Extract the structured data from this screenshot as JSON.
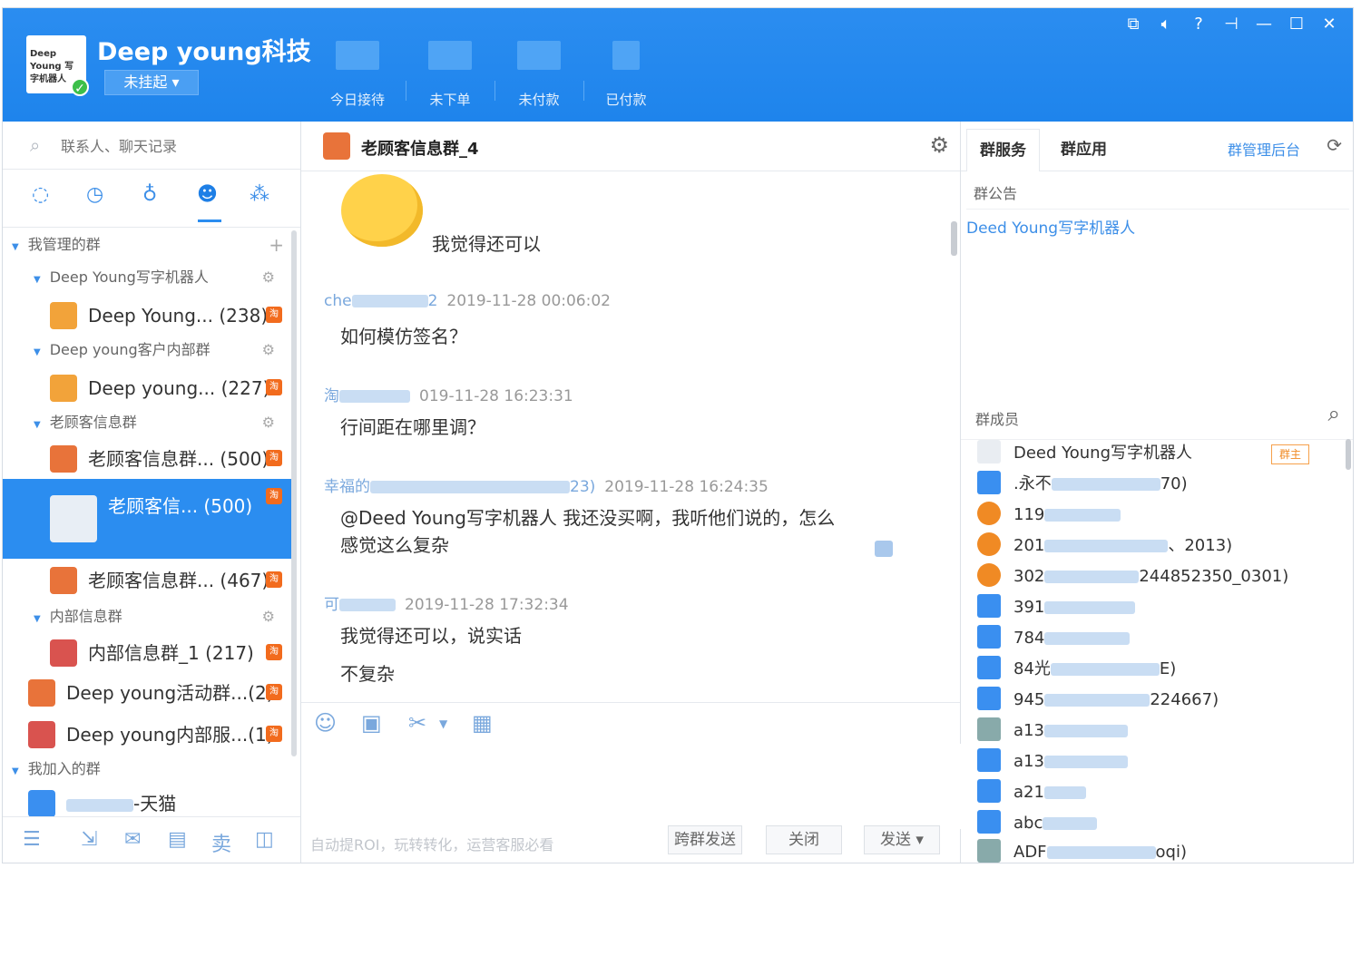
{
  "header": {
    "title": "Deep young科技",
    "logo_text": "Deep Young 写字机器人",
    "status": "未挂起",
    "stats": [
      {
        "label": "今日接待"
      },
      {
        "label": "未下单"
      },
      {
        "label": "未付款"
      },
      {
        "label": "已付款"
      }
    ]
  },
  "left": {
    "search_placeholder": "联系人、聊天记录",
    "sections": {
      "managed": "我管理的群",
      "joined": "我加入的群"
    },
    "groups": [
      {
        "name": "Deep Young写字机器人"
      },
      {
        "name": "Deep young客户内部群"
      },
      {
        "name": "老顾客信息群"
      },
      {
        "name": "内部信息群"
      }
    ],
    "items": [
      {
        "label": "Deep Young... (238)"
      },
      {
        "label": "Deep young... (227)"
      },
      {
        "label": "老顾客信息群... (500)"
      },
      {
        "label": "老顾客信...  (500)"
      },
      {
        "label": "老顾客信息群... (467)"
      },
      {
        "label": "内部信息群_1 (217)"
      },
      {
        "label": "Deep young活动群...(2)"
      },
      {
        "label": "Deep young内部服...(1)"
      }
    ],
    "joined_item": "-天猫"
  },
  "chat": {
    "title": "老顾客信息群_4",
    "messages": [
      {
        "sender": "",
        "time": "",
        "text": "我觉得还可以"
      },
      {
        "sender": "che",
        "sender_tail": "2",
        "time": "2019-11-28 00:06:02",
        "text": "如何模仿签名？"
      },
      {
        "sender": "淘",
        "sender_tail": "",
        "time": "019-11-28 16:23:31",
        "text": "行间距在哪里调？"
      },
      {
        "sender": "幸福的",
        "sender_tail": "23)",
        "time": "2019-11-28 16:24:35",
        "text": "@Deed Young写字机器人 我还没买啊，我听他们说的，怎么",
        "text2": "感觉这么复杂"
      },
      {
        "sender": "可",
        "sender_tail": "",
        "time": "2019-11-28 17:32:34",
        "text": "我觉得还可以，说实话",
        "text2": "不复杂"
      }
    ],
    "footer_hint": "自动提ROI，玩转转化，运营客服必看",
    "buttons": {
      "multi_send": "跨群发送",
      "close": "关闭",
      "send": "发送"
    }
  },
  "right": {
    "tabs": [
      "群服务",
      "群应用"
    ],
    "admin_link": "群管理后台",
    "notice_label": "群公告",
    "notice_text": "Deed Young写字机器人",
    "members_label": "群成员",
    "owner_badge": "群主",
    "members": [
      {
        "name": "Deed Young写字机器人",
        "avatar": "logo"
      },
      {
        "name": ".永不",
        "tail": "70)",
        "avatar": "blue"
      },
      {
        "name": "119",
        "tail": "",
        "avatar": "orange"
      },
      {
        "name": "201",
        "tail": "、2013)",
        "avatar": "orange"
      },
      {
        "name": "302",
        "tail": "244852350_0301)",
        "avatar": "orange"
      },
      {
        "name": "391",
        "tail": "",
        "avatar": "blue"
      },
      {
        "name": "784",
        "tail": "",
        "avatar": "blue"
      },
      {
        "name": "84光",
        "tail": "E)",
        "avatar": "blue"
      },
      {
        "name": "945",
        "tail": "224667)",
        "avatar": "blue"
      },
      {
        "name": "a13",
        "tail": "",
        "avatar": "photo"
      },
      {
        "name": "a13",
        "tail": "",
        "avatar": "blue"
      },
      {
        "name": "a21",
        "tail": "",
        "avatar": "blue"
      },
      {
        "name": "abc",
        "tail": "",
        "avatar": "blue"
      },
      {
        "name": "ADF",
        "tail": "oqi)",
        "avatar": "photo"
      }
    ]
  },
  "colors": {
    "header_blue": "#1e84ec",
    "accent": "#2b8df0",
    "link_blue": "#3d8fe8",
    "badge_orange": "#f26b1d"
  }
}
